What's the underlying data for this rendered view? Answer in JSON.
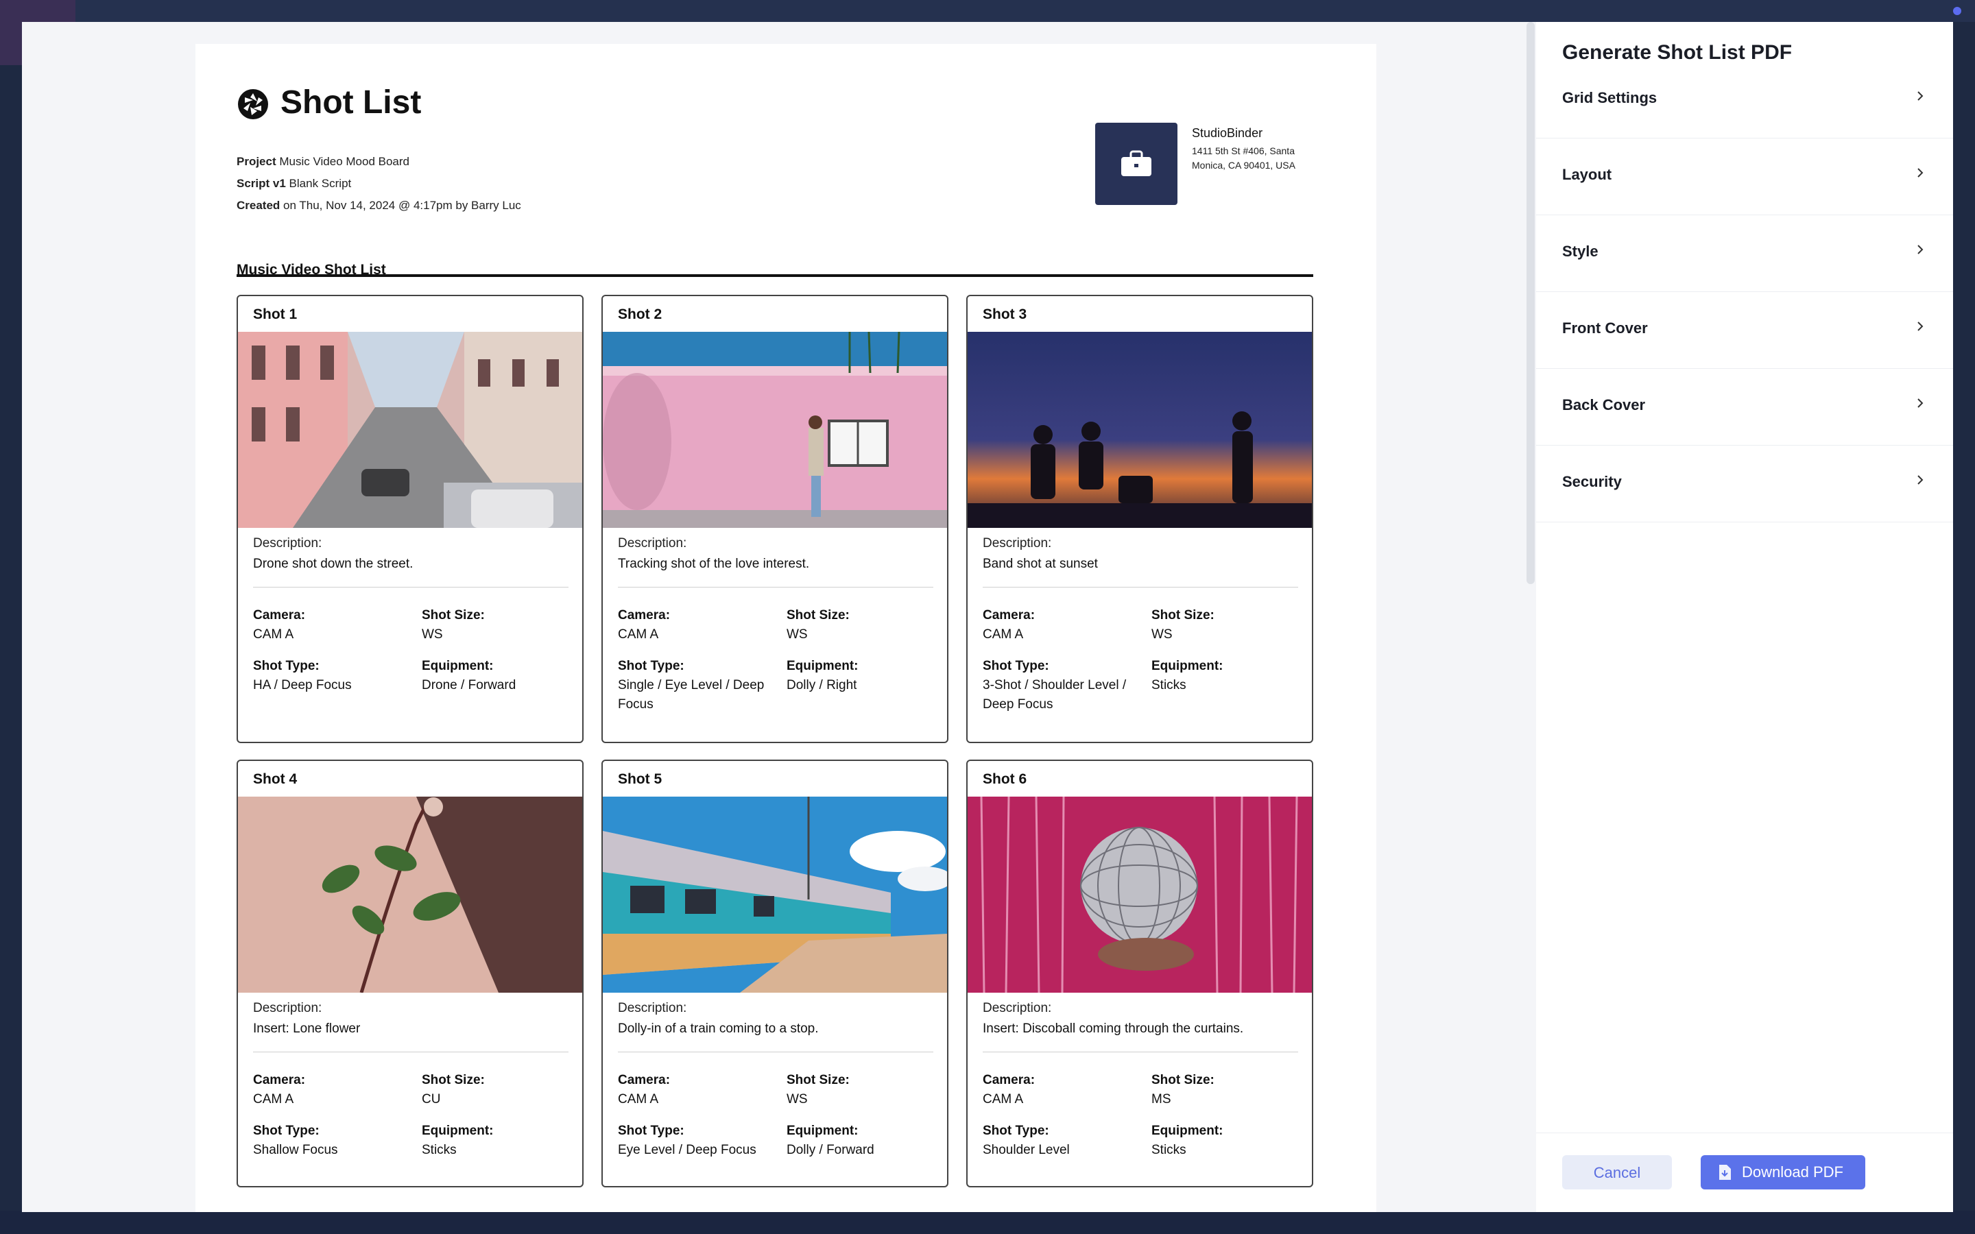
{
  "document": {
    "title": "Shot List",
    "project_label": "Project",
    "project_value": "Music Video Mood Board",
    "script_label": "Script v1",
    "script_value": "Blank Script",
    "created_label": "Created",
    "created_value": "on Thu, Nov 14, 2024 @ 4:17pm by Barry Luc",
    "section_title": "Music Video Shot List",
    "company": {
      "name": "StudioBinder",
      "address": "1411 5th St #406, Santa Monica, CA 90401, USA"
    }
  },
  "labels": {
    "description": "Description:",
    "camera": "Camera:",
    "shot_size": "Shot Size:",
    "shot_type": "Shot Type:",
    "equipment": "Equipment:"
  },
  "shots": [
    {
      "title": "Shot  1",
      "description": "Drone shot down the street.",
      "camera": "CAM A",
      "shot_size": "WS",
      "shot_type": "HA / Deep Focus",
      "equipment": "Drone / Forward",
      "image": "narrow-street-pink-buildings"
    },
    {
      "title": "Shot  2",
      "description": "Tracking shot of the love interest.",
      "camera": "CAM A",
      "shot_size": "WS",
      "shot_type": "Single / Eye Level / Deep Focus",
      "equipment": "Dolly / Right",
      "image": "woman-by-pink-wall"
    },
    {
      "title": "Shot  3",
      "description": "Band shot at sunset",
      "camera": "CAM A",
      "shot_size": "WS",
      "shot_type": "3-Shot / Shoulder Level / Deep Focus",
      "equipment": "Sticks",
      "image": "band-silhouette-sunset"
    },
    {
      "title": "Shot  4",
      "description": "Insert: Lone flower",
      "camera": "CAM A",
      "shot_size": "CU",
      "shot_type": "Shallow Focus",
      "equipment": "Sticks",
      "image": "flower-stem"
    },
    {
      "title": "Shot  5",
      "description": "Dolly-in of a train coming to a stop.",
      "camera": "CAM A",
      "shot_size": "WS",
      "shot_type": "Eye Level / Deep Focus",
      "equipment": "Dolly / Forward",
      "image": "teal-train"
    },
    {
      "title": "Shot  6",
      "description": "Insert: Discoball coming through the curtains.",
      "camera": "CAM A",
      "shot_size": "MS",
      "shot_type": "Shoulder Level",
      "equipment": "Sticks",
      "image": "discoball-pink-curtain"
    }
  ],
  "sidebar": {
    "title": "Generate Shot List PDF",
    "items": [
      {
        "label": "Grid Settings"
      },
      {
        "label": "Layout"
      },
      {
        "label": "Style"
      },
      {
        "label": "Front Cover"
      },
      {
        "label": "Back Cover"
      },
      {
        "label": "Security"
      }
    ],
    "cancel_label": "Cancel",
    "download_label": "Download PDF"
  }
}
